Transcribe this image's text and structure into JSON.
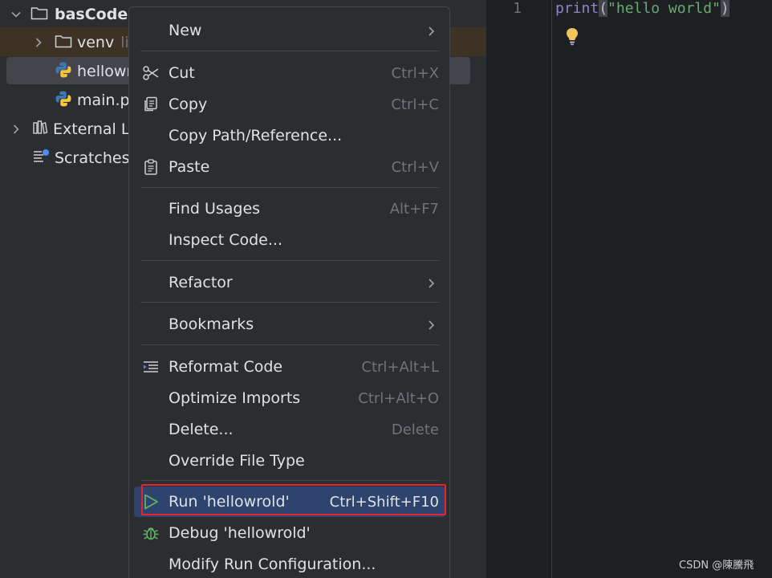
{
  "tree": {
    "root": {
      "label": "basCode"
    },
    "venv": {
      "label": "venv",
      "hint": "li"
    },
    "hellowrold": {
      "label": "hellowr"
    },
    "main": {
      "label": "main.py"
    },
    "external": {
      "label": "External L"
    },
    "scratches": {
      "label": "Scratches"
    }
  },
  "editor": {
    "line_number": "1",
    "code": {
      "fn": "print",
      "open": "(",
      "str": "\"hello world\"",
      "close": ")"
    }
  },
  "menu": {
    "new": "New",
    "cut": {
      "label": "Cut",
      "shortcut": "Ctrl+X"
    },
    "copy": {
      "label": "Copy",
      "shortcut": "Ctrl+C"
    },
    "copy_path": "Copy Path/Reference...",
    "paste": {
      "label": "Paste",
      "shortcut": "Ctrl+V"
    },
    "find_usages": {
      "label": "Find Usages",
      "shortcut": "Alt+F7"
    },
    "inspect_code": "Inspect Code...",
    "refactor": "Refactor",
    "bookmarks": "Bookmarks",
    "reformat": {
      "label": "Reformat Code",
      "shortcut": "Ctrl+Alt+L"
    },
    "optimize_imports": {
      "label": "Optimize Imports",
      "shortcut": "Ctrl+Alt+O"
    },
    "delete": {
      "label": "Delete...",
      "shortcut": "Delete"
    },
    "override_file_type": "Override File Type",
    "run": {
      "label": "Run 'hellowrold'",
      "shortcut": "Ctrl+Shift+F10"
    },
    "debug": "Debug 'hellowrold'",
    "modify_run": "Modify Run Configuration..."
  },
  "watermark": "CSDN @陳騰飛",
  "colors": {
    "accent_selection": "#2e436e",
    "highlight_box": "#e5252e",
    "string": "#6aab73",
    "keyword": "#8888c6"
  },
  "icons": [
    "chevron-down-icon",
    "chevron-right-icon",
    "folder-icon",
    "python-file-icon",
    "library-icon",
    "scratches-icon",
    "scissors-icon",
    "copy-icon",
    "clipboard-icon",
    "reformat-icon",
    "run-icon",
    "debug-icon",
    "lightbulb-icon"
  ]
}
